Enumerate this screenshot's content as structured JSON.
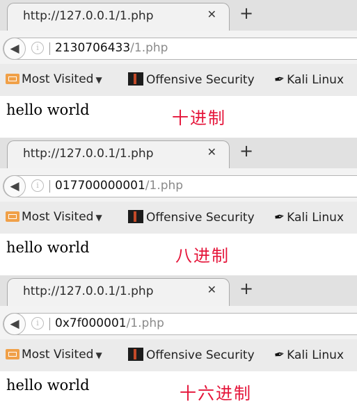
{
  "panels": [
    {
      "tab_title": "http://127.0.0.1/1.php",
      "url_host": "2130706433",
      "url_path": "/1.php",
      "page_text": "hello world",
      "annotation": "十进制"
    },
    {
      "tab_title": "http://127.0.0.1/1.php",
      "url_host": "017700000001",
      "url_path": "/1.php",
      "page_text": "hello world",
      "annotation": "八进制"
    },
    {
      "tab_title": "http://127.0.0.1/1.php",
      "url_host": "0x7f000001",
      "url_path": "/1.php",
      "page_text": "hello world",
      "annotation": "十六进制"
    }
  ],
  "bookmarks": {
    "most_visited": "Most Visited",
    "offensive_security": "Offensive Security",
    "kali_linux": "Kali Linux"
  },
  "icons": {
    "tab_close": "close-icon",
    "new_tab": "plus-icon",
    "back": "back-arrow-icon",
    "info": "info-icon",
    "folder": "folder-icon",
    "chevron": "chevron-down-icon",
    "offensive": "offensive-security-icon",
    "kali": "kali-dragon-icon"
  },
  "colors": {
    "annotation": "#e5153a",
    "folder": "#f0a048"
  }
}
